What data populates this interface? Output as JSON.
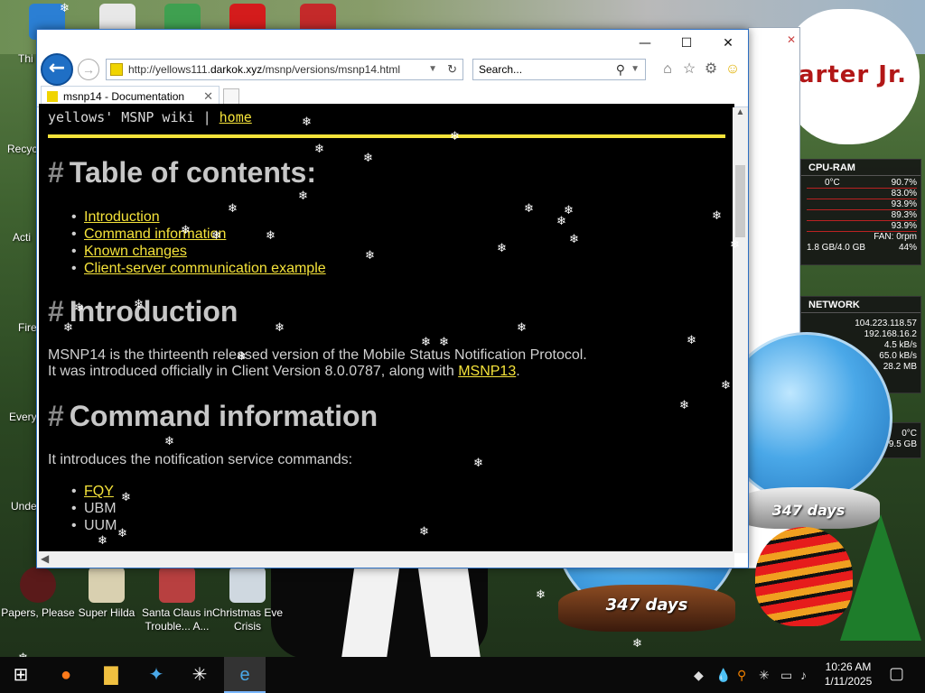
{
  "browser": {
    "url_prefix": "http://yellows111.",
    "url_domain": "darkok.xyz",
    "url_path": "/msnp/versions/msnp14.html",
    "search_placeholder": "Search...",
    "tab_label": "msnp14 - Documentation",
    "window_controls": {
      "minimize": "—",
      "maximize": "☐",
      "close": "✕"
    }
  },
  "page": {
    "header_text": "yellows' MSNP wiki | ",
    "header_link": "home",
    "toc_heading": "Table of contents:",
    "toc_items": [
      "Introduction",
      "Command information",
      "Known changes",
      "Client-server communication example"
    ],
    "intro_heading": "Introduction",
    "intro_line1": "MSNP14 is the thirteenth released version of the Mobile Status Notification Protocol.",
    "intro_line2": "It was introduced officially in Client Version 8.0.0787, along with ",
    "intro_link": "MSNP13",
    "intro_end": ".",
    "cmd_heading": "Command information",
    "cmd_intro": "It introduces the notification service commands:",
    "cmd_items": [
      "FQY",
      "UBM",
      "UUM"
    ],
    "heading_hash": "#"
  },
  "desktop": {
    "bg_text": "arter Jr.",
    "icons": [
      {
        "label": "Papers, Please"
      },
      {
        "label": "Super Hilda"
      },
      {
        "label": "Santa Claus in Trouble... A..."
      },
      {
        "label": "Christmas Eve Crisis"
      }
    ],
    "left_labels": [
      "Thi",
      "Recycl",
      "Acti",
      "Fire",
      "Every",
      "Unde"
    ]
  },
  "cpu_widget": {
    "title": "CPU-RAM",
    "temp": "0°C",
    "values": [
      "90.7%",
      "83.0%",
      "93.9%",
      "89.3%",
      "93.9%"
    ],
    "fan": "FAN: 0rpm",
    "ram": "1.8 GB/4.0 GB",
    "ram_pct": "44%"
  },
  "net_widget": {
    "title": "NETWORK",
    "ip1": "104.223.118.57",
    "ip2": "192.168.16.2",
    "down": "4.5 kB/s",
    "up": "65.0 kB/s",
    "total": "28.2 MB"
  },
  "hdd_widget": {
    "temp": "0°C",
    "size": "9.5 GB"
  },
  "snow_globes": {
    "days_small": "347 days",
    "days_large": "347 days"
  },
  "taskbar": {
    "time": "10:26 AM",
    "date": "1/11/2025"
  },
  "colors": {
    "link": "#f5e33a",
    "page_bg": "#000000",
    "ie_blue": "#1f6fc5"
  }
}
